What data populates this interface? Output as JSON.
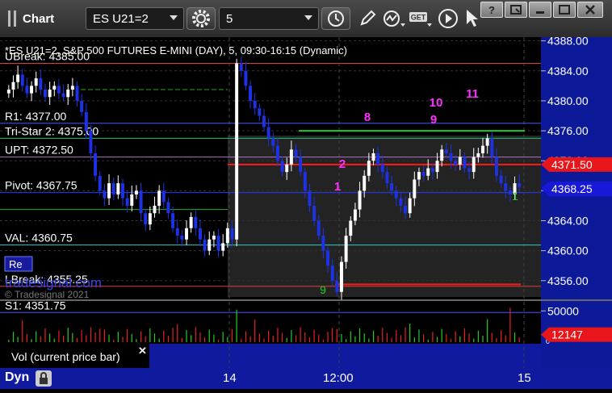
{
  "toolbar": {
    "title": "Chart",
    "instrument": "ES U21=2",
    "interval": "5",
    "get_label": "GET",
    "help_label": "?"
  },
  "chart": {
    "header_text": "*ES U21=2, S&P 500 FUTURES E-MINI (DAY), 5, 09:30-16:15 (Dynamic)",
    "watermark_line1": "tradesignal.com",
    "watermark_line2": "© Tradesignal 2021",
    "badge": "Re"
  },
  "chart_data": {
    "type": "candlestick",
    "price_axis": {
      "ticks": [
        "4388.00",
        "4384.00",
        "4380.00",
        "4376.00",
        "4372.00",
        "4368.00",
        "4364.00",
        "4360.00",
        "4356.00"
      ],
      "range": [
        4353.5,
        4388.5
      ]
    },
    "price_tags": [
      {
        "value": 4371.5,
        "label": "4371.50",
        "color": "#e8161a"
      },
      {
        "value": 4368.25,
        "label": "4368.25",
        "color": "#1818d8"
      }
    ],
    "levels": [
      {
        "label": "UBreak: 4385.00",
        "value": 4385.0,
        "color": "#e23a3a"
      },
      {
        "label": "R1: 4377.00",
        "value": 4377.0,
        "color": "#3f58ff"
      },
      {
        "label": "Tri-Star 2: 4375.00",
        "value": 4375.0,
        "color": "#20c070"
      },
      {
        "label": "UPT: 4372.50",
        "value": 4372.5,
        "color": "#b070c8"
      },
      {
        "label": "Pivot: 4367.75",
        "value": 4367.75,
        "color": "#2a3aff"
      },
      {
        "label": "VAL: 4360.75",
        "value": 4360.75,
        "color": "#30c8d0"
      },
      {
        "label": "LBreak: 4355.25",
        "value": 4355.25,
        "color": "#e23a3a"
      },
      {
        "label": "S1: 4351.75",
        "value": 4351.75,
        "color": "#3f58ff"
      }
    ],
    "time_labels": [
      "14",
      "12:00",
      "15"
    ],
    "td_counts_magenta": [
      "1",
      "2",
      "8",
      "9",
      "10",
      "11"
    ],
    "td_counts_green": [
      "9",
      "1"
    ],
    "volume": {
      "label": "Vol (current price bar)",
      "ticks": [
        "50000",
        "0"
      ],
      "last_value": "12147",
      "last_color": "#e8161a"
    }
  },
  "status": {
    "mode": "Dyn"
  },
  "colors": {
    "up": "#ffffff",
    "down": "#1d32e6",
    "panel": "#1a1a1a",
    "status_bar": "#0f1a9e",
    "magenta": "#ff30ff",
    "green_count": "#22cc22"
  }
}
